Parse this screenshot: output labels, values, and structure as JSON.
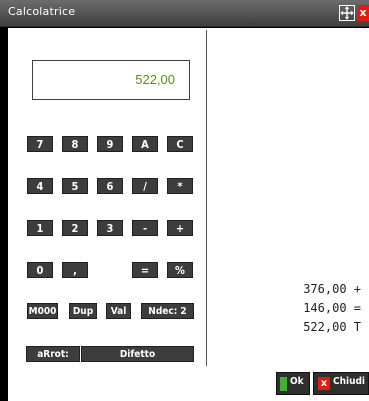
{
  "window": {
    "title": "Calcolatrice",
    "icons": {
      "maximize": "maximize-icon",
      "close": "close-icon"
    },
    "close_glyph": "x"
  },
  "display": {
    "value": "522,00"
  },
  "keypad": {
    "row1": [
      "7",
      "8",
      "9",
      "A",
      "C"
    ],
    "row2": [
      "4",
      "5",
      "6",
      "/",
      "*"
    ],
    "row3": [
      "1",
      "2",
      "3",
      "-",
      "+"
    ],
    "row4": [
      "0",
      ",",
      "=",
      "%"
    ],
    "row5": {
      "m000": "M000",
      "dup": "Dup",
      "val": "Val",
      "ndec": "Ndec:  2"
    },
    "round": {
      "label": "aRrot:",
      "value": "Difetto"
    }
  },
  "tape": [
    "376,00 +",
    "146,00 =",
    "522,00 T"
  ],
  "footer": {
    "ok_label": "Ok",
    "close_label": "Chiudi",
    "close_glyph": "x"
  },
  "colors": {
    "titlebar": "#4e4e4e",
    "key_bg": "#3d3d3d",
    "display_text": "#5b8e1f",
    "ok_accent": "#46b030",
    "close_accent": "#e31a14"
  }
}
